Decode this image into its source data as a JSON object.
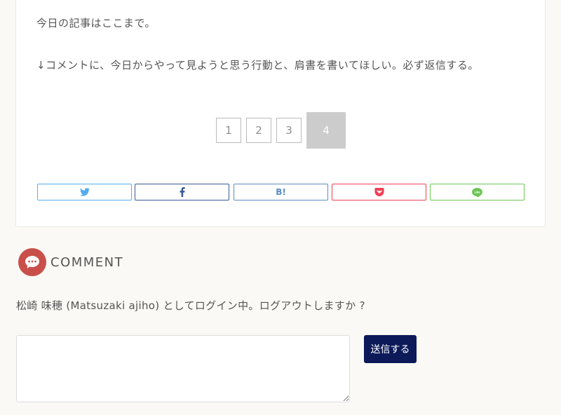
{
  "article": {
    "closing_line": "今日の記事はここまで。",
    "request_line": "↓コメントに、今日からやって見ようと思う行動と、肩書を書いてほしい。必ず返信する。"
  },
  "pagination": {
    "pages": [
      "1",
      "2",
      "3"
    ],
    "current": "4"
  },
  "share": {
    "buttons": [
      {
        "service": "twitter",
        "icon": "twitter-bird-icon",
        "color": "#55acee"
      },
      {
        "service": "facebook",
        "icon": "facebook-f-icon",
        "color": "#3b5998"
      },
      {
        "service": "hatena",
        "label": "B!",
        "color": "#5d8ac1"
      },
      {
        "service": "pocket",
        "icon": "pocket-icon",
        "color": "#ef4056"
      },
      {
        "service": "line",
        "icon": "line-icon",
        "label": "LINE",
        "color": "#6cc655"
      }
    ]
  },
  "comments": {
    "title": "COMMENT",
    "badge_color": "#c9504a",
    "login_prefix": "松崎 味穂 (Matsuzaki ajiho) としてログイン中。",
    "logout_text": "ログアウトしますか ?",
    "textarea_value": "",
    "submit_label": "送信する",
    "submit_color": "#0c1a5a"
  }
}
